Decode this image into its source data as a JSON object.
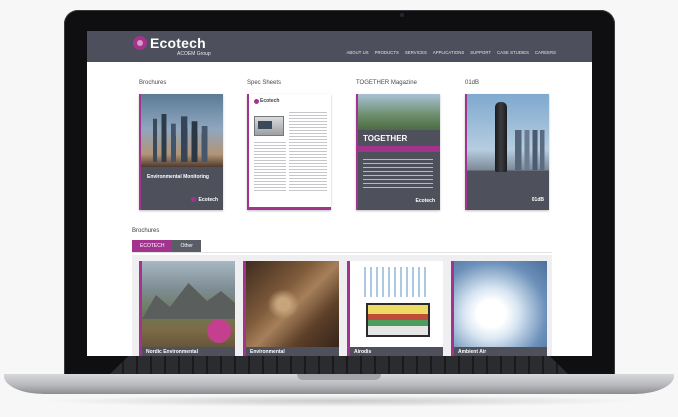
{
  "site": {
    "brand": "Ecotech",
    "group": "ACOEM Group",
    "nav": [
      "ABOUT US",
      "PRODUCTS",
      "SERVICES",
      "APPLICATIONS",
      "SUPPORT",
      "CASE STUDIES",
      "CAREERS"
    ]
  },
  "documents": [
    {
      "category": "Brochures",
      "cover_title": "Environmental Monitoring",
      "cover_brand": "Ecotech"
    },
    {
      "category": "Spec Sheets",
      "cover_brand": "Ecotech"
    },
    {
      "category": "TOGETHER Magazine",
      "cover_title": "TOGETHER",
      "cover_brand": "Ecotech"
    },
    {
      "category": "01dB",
      "cover_brand": "01dB"
    }
  ],
  "section": {
    "title": "Brochures",
    "tabs": [
      {
        "label": "ECOTECH",
        "active": true
      },
      {
        "label": "Other",
        "active": false
      }
    ]
  },
  "cards": [
    {
      "caption": "Nordic Environmental"
    },
    {
      "caption": "Environmental"
    },
    {
      "caption": "Airodis"
    },
    {
      "caption": "Ambient Air"
    }
  ],
  "colors": {
    "accent": "#a3348e",
    "header": "#4d505c",
    "bezel": "#0f0f11"
  },
  "icons": {
    "logo": "ecotech-logo-icon"
  }
}
